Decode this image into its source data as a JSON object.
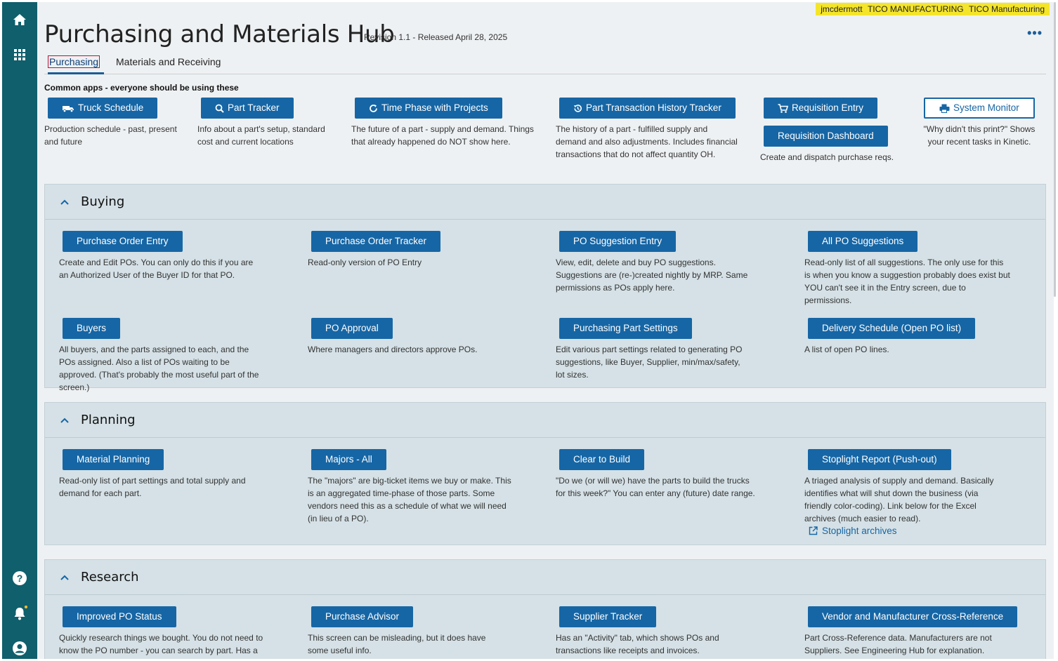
{
  "user": {
    "name": "jmcdermott",
    "company": "TICO MANUFACTURING",
    "site": "TICO Manufacturing"
  },
  "header": {
    "title": "Purchasing and Materials Hub",
    "revision": "Revision 1.1 - Released April 28, 2025",
    "more_label": "•••"
  },
  "tabs": [
    {
      "label": "Purchasing"
    },
    {
      "label": "Materials and Receiving"
    }
  ],
  "common": {
    "heading": "Common apps - everyone should be using these",
    "apps": [
      {
        "label": "Truck Schedule",
        "icon": "truck-icon",
        "desc": "Production schedule - past, present and future"
      },
      {
        "label": "Part Tracker",
        "icon": "search-icon",
        "desc": "Info about a part's setup, standard cost and current locations"
      },
      {
        "label": "Time Phase with Projects",
        "icon": "refresh-icon",
        "desc": "The future of a part - supply and demand. Things that already happened do NOT show here."
      },
      {
        "label": "Part Transaction History Tracker",
        "icon": "history-icon",
        "desc": "The history of a part - fulfilled supply and demand and also adjustments. Includes financial transactions that do not affect quantity OH."
      },
      {
        "label": "Requisition Entry",
        "icon": "cart-icon",
        "desc": ""
      },
      {
        "label": "Requisition Dashboard",
        "icon": "",
        "desc": "Create and dispatch purchase reqs."
      },
      {
        "label": "System Monitor",
        "icon": "printer-icon",
        "desc": "\"Why didn't this print?\" Shows your recent tasks in Kinetic."
      }
    ]
  },
  "sections": [
    {
      "title": "Buying",
      "items": [
        {
          "label": "Purchase Order Entry",
          "desc": "Create and Edit POs. You can only do this if you are an Authorized User of the Buyer ID for that PO."
        },
        {
          "label": "Purchase Order Tracker",
          "desc": "Read-only version of PO Entry"
        },
        {
          "label": "PO Suggestion Entry",
          "desc": "View, edit, delete and buy PO suggestions. Suggestions are (re-)created nightly by MRP. Same permissions as POs apply here."
        },
        {
          "label": "All PO Suggestions",
          "desc": "Read-only list of all suggestions. The only use for this is when you know a suggestion probably does exist but YOU can't see it in the Entry screen, due to permissions."
        },
        {
          "label": "Buyers",
          "desc": "All buyers, and the parts assigned to each, and the POs assigned. Also a list of POs waiting to be approved. (That's probably the most useful part of the screen.)"
        },
        {
          "label": "PO Approval",
          "desc": "Where managers and directors approve POs."
        },
        {
          "label": "Purchasing Part Settings",
          "desc": "Edit various part settings related to generating PO suggestions, like Buyer, Supplier, min/max/safety, lot sizes."
        },
        {
          "label": "Delivery Schedule (Open PO list)",
          "desc": "A list of open PO lines."
        }
      ]
    },
    {
      "title": "Planning",
      "items": [
        {
          "label": "Material Planning",
          "desc": "Read-only list of part settings and total supply and demand for each part."
        },
        {
          "label": "Majors - All",
          "desc": "The \"majors\" are big-ticket items we buy or make. This is an aggregated time-phase of those parts. Some vendors need this as a schedule of what we will need (in lieu of a PO)."
        },
        {
          "label": "Clear to Build",
          "desc": "\"Do we (or will we) have the parts to build the trucks for this week?\" You can enter any (future) date range."
        },
        {
          "label": "Stoplight Report (Push-out)",
          "desc": "A triaged analysis of supply and demand. Basically identifies what will shut down the business (via friendly color-coding). Link below for the Excel archives (much easier to read)."
        }
      ],
      "link": {
        "label": "Stoplight archives",
        "icon": "external-link-icon"
      }
    },
    {
      "title": "Research",
      "items": [
        {
          "label": "Improved PO Status",
          "desc": "Quickly research things we bought. You do not need to know the PO number - you can search by part. Has a lot of useful info."
        },
        {
          "label": "Purchase Advisor",
          "desc": "This screen can be misleading, but it does have some useful info."
        },
        {
          "label": "Supplier Tracker",
          "desc": "Has an \"Activity\" tab, which shows POs and transactions like receipts and invoices."
        },
        {
          "label": "Vendor and Manufacturer Cross-Reference",
          "desc": "Part Cross-Reference data. Manufacturers are not Suppliers. See Engineering Hub for explanation."
        }
      ]
    }
  ],
  "colors": {
    "rail": "#0f5f6c",
    "button": "#1666a5",
    "section_bg": "#d5e1e6",
    "user_badge": "#f5e52a"
  }
}
